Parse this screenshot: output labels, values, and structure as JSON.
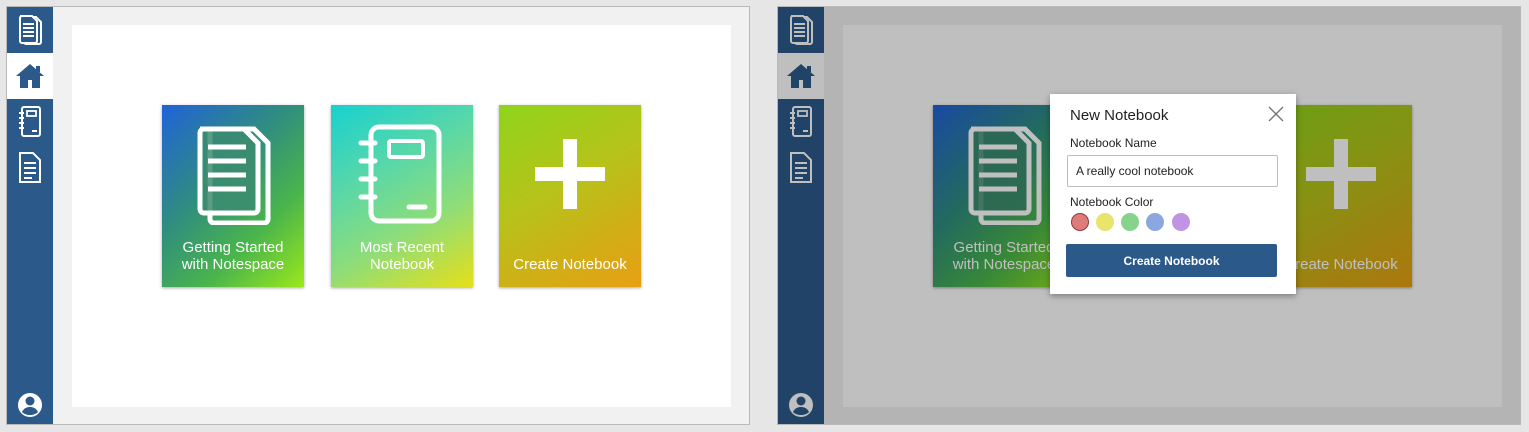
{
  "tiles": [
    {
      "label": "Getting Started\nwith Notespace",
      "icon": "documents-icon"
    },
    {
      "label": "Most Recent\nNotebook",
      "icon": "notebook-icon"
    },
    {
      "label": "Create Notebook",
      "icon": "plus-icon"
    }
  ],
  "sidebar": {
    "items": [
      {
        "name": "documents",
        "icon": "documents-icon"
      },
      {
        "name": "home",
        "icon": "home-icon",
        "active_left": true
      },
      {
        "name": "notebooks",
        "icon": "notebook-icon"
      },
      {
        "name": "notes",
        "icon": "page-icon"
      },
      {
        "name": "account",
        "icon": "account-icon"
      }
    ]
  },
  "modal": {
    "title": "New Notebook",
    "name_label": "Notebook Name",
    "name_value": "A really cool notebook",
    "color_label": "Notebook Color",
    "colors": [
      "#e07b7b",
      "#e8e46c",
      "#86d38c",
      "#8ba7df",
      "#c194e3"
    ],
    "selected_color_index": 0,
    "create_label": "Create Notebook"
  },
  "colors": {
    "sidebar": "#2b5a8a",
    "primary_button": "#2b5a8a"
  }
}
